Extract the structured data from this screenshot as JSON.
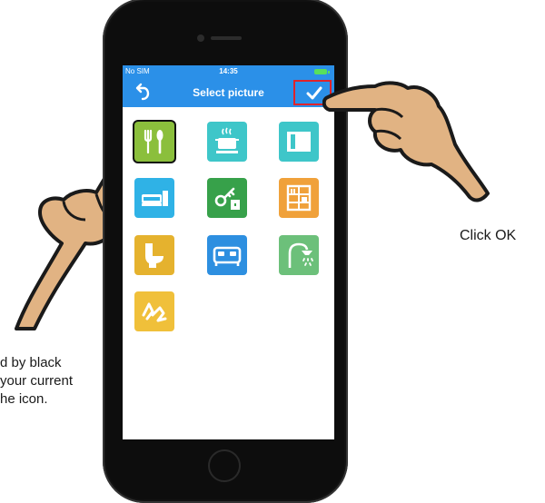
{
  "status_bar": {
    "carrier": "No SIM",
    "time": "14:35"
  },
  "nav_bar": {
    "title": "Select picture",
    "back_icon": "back-arrow-icon",
    "ok_icon": "checkmark-icon"
  },
  "icons": [
    {
      "name": "restaurant",
      "icon": "fork-spoon-icon",
      "color": "#8bbf3c",
      "selected": true
    },
    {
      "name": "kitchen",
      "icon": "cooking-pot-icon",
      "color": "#3ec6c9",
      "selected": false
    },
    {
      "name": "window",
      "icon": "window-panel-icon",
      "color": "#3ec6c9",
      "selected": false
    },
    {
      "name": "living-room",
      "icon": "sofa-tv-icon",
      "color": "#2fb2e6",
      "selected": false
    },
    {
      "name": "entrance",
      "icon": "key-door-icon",
      "color": "#37a14a",
      "selected": false
    },
    {
      "name": "study",
      "icon": "bookshelf-icon",
      "color": "#f0a13a",
      "selected": false
    },
    {
      "name": "toilet",
      "icon": "toilet-icon",
      "color": "#e5b22e",
      "selected": false
    },
    {
      "name": "bedroom",
      "icon": "bed-icon",
      "color": "#2d8fe0",
      "selected": false
    },
    {
      "name": "shower",
      "icon": "shower-icon",
      "color": "#6cc07a",
      "selected": false
    },
    {
      "name": "other",
      "icon": "scribble-icon",
      "color": "#f0c03a",
      "selected": false
    }
  ],
  "annotations": {
    "click_ok": "Click OK",
    "left_note_lines": [
      "d by black",
      "your current",
      "he icon."
    ]
  }
}
